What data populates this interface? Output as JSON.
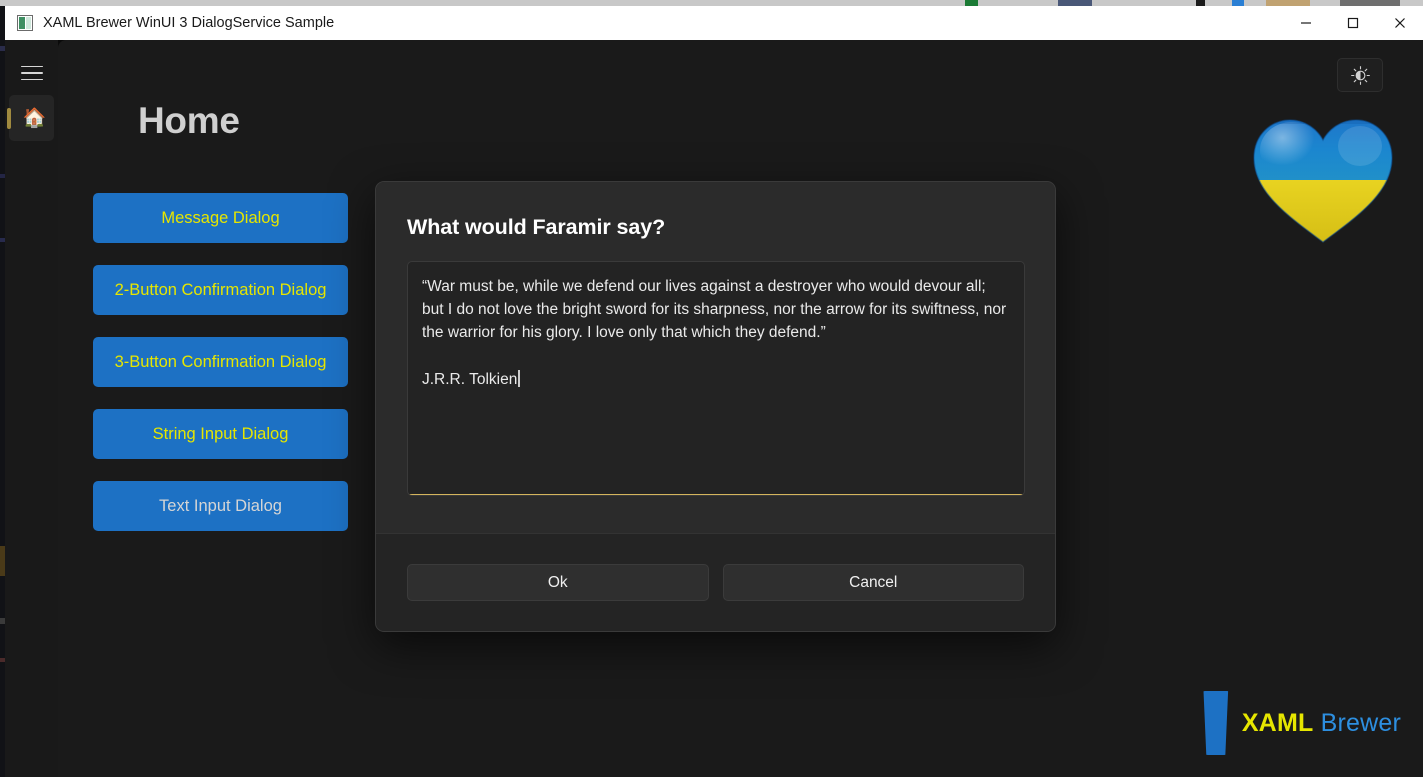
{
  "window": {
    "title": "XAML Brewer WinUI 3 DialogService Sample",
    "app_icon": "app-tile-icon",
    "controls": {
      "minimize": "minimize-icon",
      "maximize": "maximize-icon",
      "close": "close-icon"
    }
  },
  "navrail": {
    "menu_icon": "hamburger-icon",
    "items": [
      {
        "icon": "house-emoji",
        "glyph": "🏠",
        "label": "Home",
        "selected": true
      }
    ]
  },
  "page": {
    "title": "Home",
    "theme_toggle_icon": "brightness-sun-icon",
    "heart_icon": "ukraine-heart-icon",
    "help_label": "?",
    "brand": {
      "glass_icon": "beer-glass-icon",
      "name_first": "XAML",
      "name_second": "Brewer"
    }
  },
  "actions": {
    "buttons": [
      {
        "label": "Message Dialog",
        "style": "accent-yellow"
      },
      {
        "label": "2-Button Confirmation Dialog",
        "style": "accent-yellow"
      },
      {
        "label": "3-Button Confirmation Dialog",
        "style": "accent-yellow"
      },
      {
        "label": "String Input Dialog",
        "style": "accent-yellow"
      },
      {
        "label": "Text Input Dialog",
        "style": "accent-plain"
      }
    ]
  },
  "dialog": {
    "title": "What would Faramir say?",
    "textbox": {
      "quote": "“War must be, while we defend our lives against a destroyer who would devour all; but I do not love the bright sword for its sharpness, nor the arrow for its swiftness, nor the warrior for his glory. I love only that which they defend.”",
      "author": "J.R.R. Tolkien",
      "focused": true,
      "accent_color": "#d4b45c"
    },
    "primary_button": "Ok",
    "secondary_button": "Cancel"
  },
  "colors": {
    "accent_blue": "#1d71c4",
    "accent_yellow": "#e6e600",
    "surface": "#1a1a1a",
    "dialog_surface": "#2b2b2b",
    "titlebar": "#ffffff"
  }
}
